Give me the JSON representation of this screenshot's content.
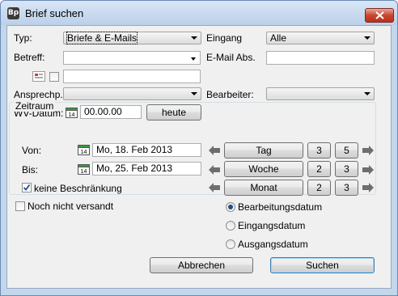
{
  "window": {
    "title": "Brief suchen",
    "icon_text": "Bp"
  },
  "form": {
    "typ": {
      "label": "Typ:",
      "value": "Briefe & E-Mails"
    },
    "eingang": {
      "label": "Eingang",
      "value": "Alle"
    },
    "betreff": {
      "label": "Betreff:",
      "value": ""
    },
    "email_abs": {
      "label": "E-Mail Abs.",
      "value": ""
    },
    "ansprechp": {
      "label": "Ansprechp.:",
      "value": ""
    },
    "bearbeiter": {
      "label": "Bearbeiter:",
      "value": ""
    },
    "wv_datum": {
      "label": "WV-Datum:",
      "value": "00.00.00",
      "button": "heute",
      "calendar_day": "14"
    }
  },
  "zeitraum": {
    "title": "Zeitraum",
    "von": {
      "label": "Von:",
      "value": "Mo, 18. Feb 2013"
    },
    "bis": {
      "label": "Bis:",
      "value": "Mo, 25. Feb 2013"
    },
    "keine_beschraenkung": {
      "label": "keine Beschränkung",
      "checked": true
    },
    "rows": [
      {
        "unit": "Tag",
        "a": "3",
        "b": "5"
      },
      {
        "unit": "Woche",
        "a": "2",
        "b": "3"
      },
      {
        "unit": "Monat",
        "a": "2",
        "b": "3"
      }
    ]
  },
  "noch_nicht_versandt": {
    "label": "Noch nicht versandt",
    "checked": false
  },
  "date_type": {
    "options": [
      "Bearbeitungsdatum",
      "Eingangsdatum",
      "Ausgangsdatum"
    ],
    "selected": "Bearbeitungsdatum"
  },
  "buttons": {
    "cancel": "Abbrechen",
    "search": "Suchen"
  },
  "colors": {
    "arrow_gray": "#6e6e6e",
    "calendar_green": "#3a9a3a",
    "close_red": "#c9452d"
  },
  "icons": {
    "close": "close-icon",
    "calendar": "calendar-icon",
    "arrow_left": "arrow-left-icon",
    "arrow_right": "arrow-right-icon"
  }
}
